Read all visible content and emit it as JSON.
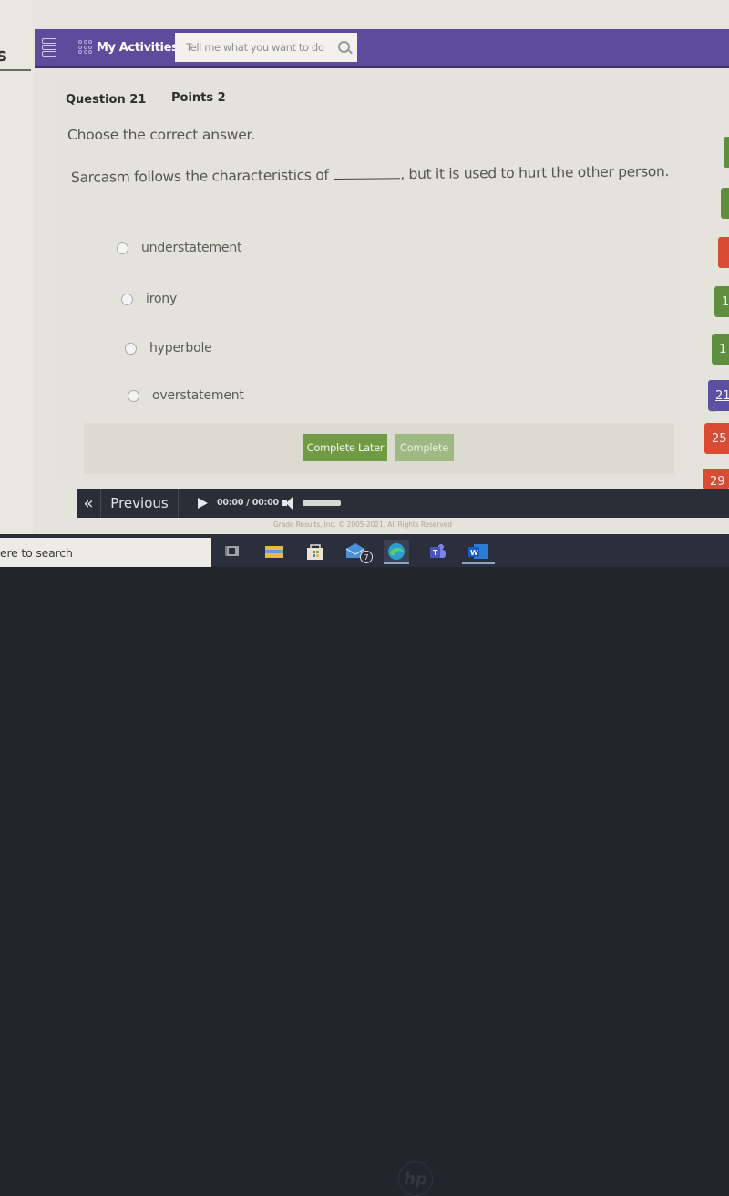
{
  "browser_tab": {
    "glyph": "s"
  },
  "header": {
    "menu_icon": "hamburger-stack-icon",
    "activities_icon": "grid-dots-icon",
    "activities_label": "My Activities",
    "search": {
      "placeholder": "Tell me what you want to do",
      "value": "",
      "icon": "search-icon"
    },
    "accent_color": "#5f4b9b"
  },
  "question": {
    "number_label": "Question 21",
    "points_label": "Points 2",
    "instruction": "Choose the correct answer.",
    "text_before": "Sarcasm follows the characteristics of",
    "text_after": ", but it is used to hurt the other person.",
    "options": [
      {
        "label": "understatement",
        "selected": false
      },
      {
        "label": "irony",
        "selected": false
      },
      {
        "label": "hyperbole",
        "selected": false
      },
      {
        "label": "overstatement",
        "selected": false
      }
    ]
  },
  "actions": {
    "complete_later": "Complete Later",
    "complete": "Complete",
    "complete_later_color": "#709a44",
    "complete_color": "#9fb985"
  },
  "question_nav": {
    "tiles": [
      {
        "label": "",
        "status": "green"
      },
      {
        "label": "",
        "status": "green"
      },
      {
        "label": "",
        "status": "red"
      },
      {
        "label": "1",
        "status": "green"
      },
      {
        "label": "1",
        "status": "green"
      },
      {
        "label": "21",
        "status": "current"
      },
      {
        "label": "25",
        "status": "red"
      },
      {
        "label": "29",
        "status": "red"
      }
    ],
    "colors": {
      "green": "#5f8f3e",
      "red": "#d94b33",
      "current": "#5b4ea3"
    }
  },
  "bottom_bar": {
    "prev_icon": "double-chevron-left-icon",
    "previous_label": "Previous",
    "play_icon": "play-icon",
    "time": "00:00 / 00:00",
    "volume_icon": "speaker-icon"
  },
  "copyright": "Grade Results, Inc. © 2005-2021. All Rights Reserved",
  "taskbar": {
    "search_text": "ere to search",
    "icons": [
      {
        "name": "task-view-icon"
      },
      {
        "name": "file-explorer-icon"
      },
      {
        "name": "microsoft-store-icon"
      },
      {
        "name": "mail-icon",
        "badge": "7"
      },
      {
        "name": "edge-icon",
        "active": true
      },
      {
        "name": "teams-icon"
      },
      {
        "name": "word-icon",
        "active": true
      }
    ]
  },
  "device": {
    "logo": "hp"
  }
}
